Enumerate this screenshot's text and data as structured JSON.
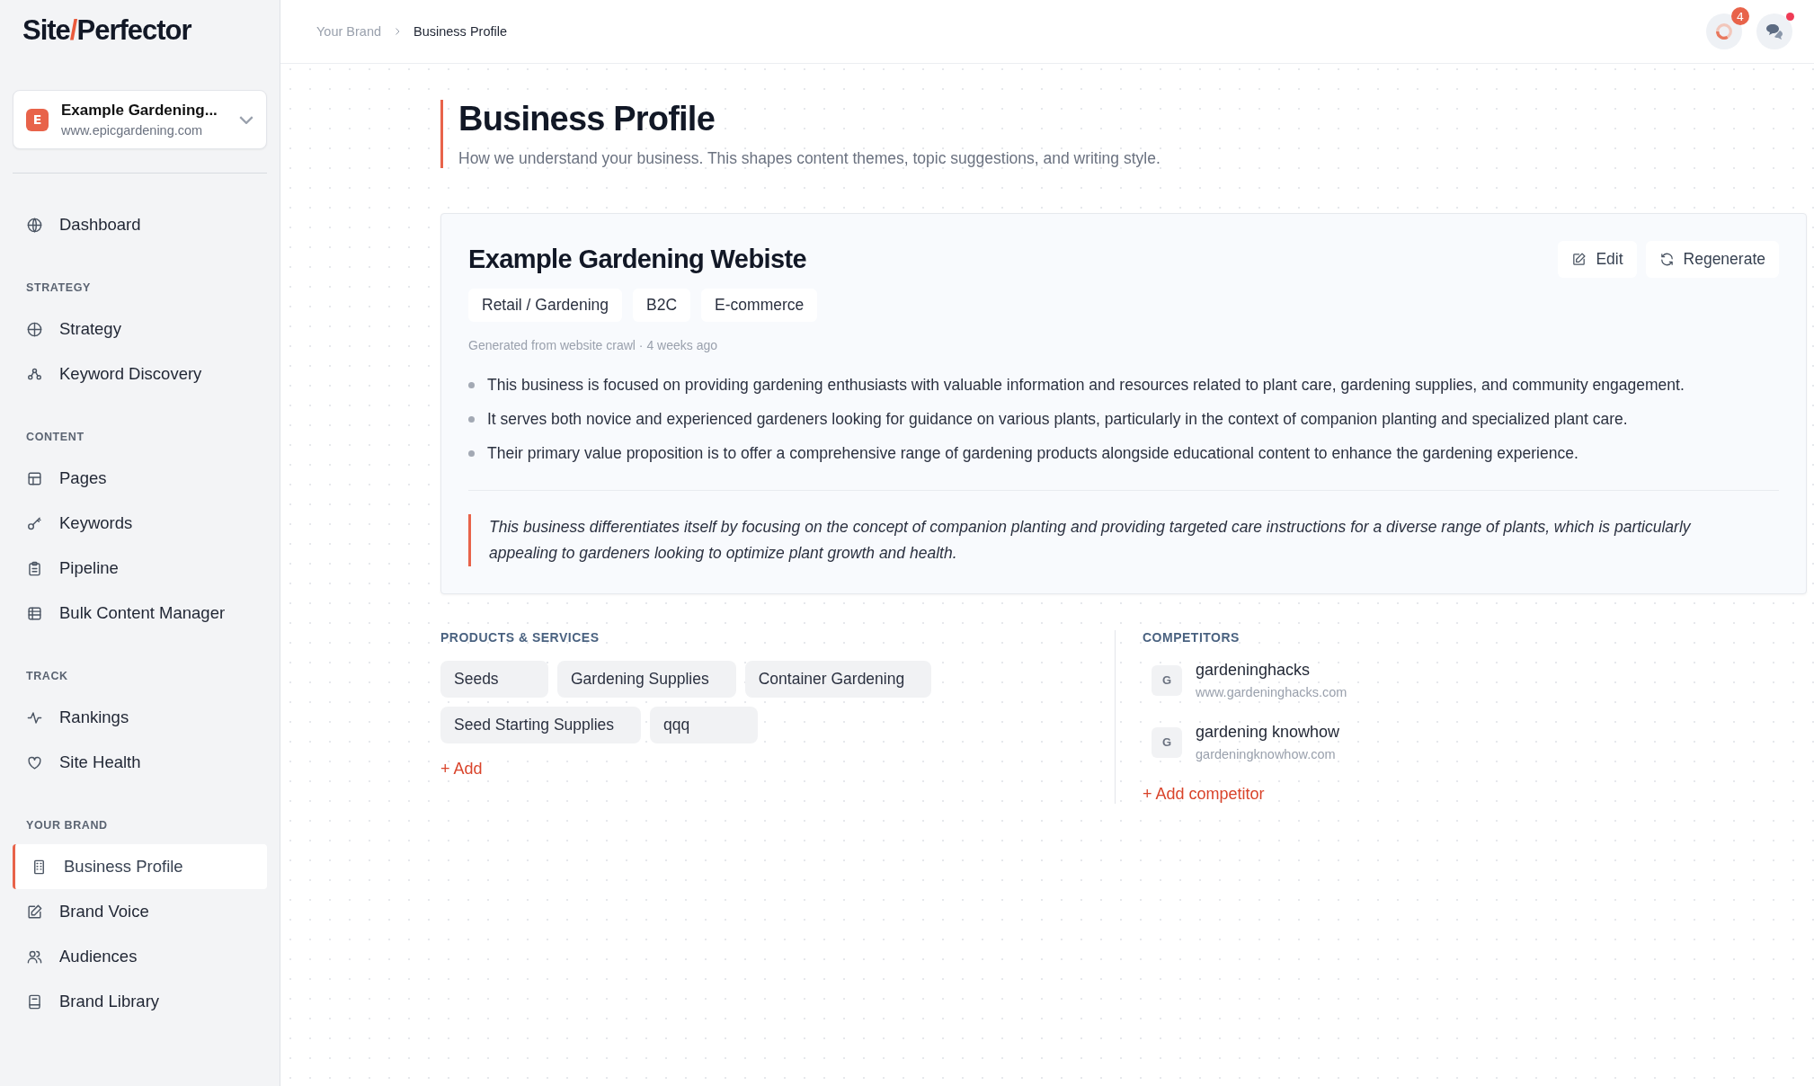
{
  "logo": [
    "Site",
    "/",
    "Perfector"
  ],
  "account": {
    "initial": "E",
    "name": "Example Gardening...",
    "url": "www.epicgardening.com"
  },
  "nav": [
    {
      "label": "Dashboard",
      "selected": false
    }
  ],
  "nav_sections": [
    {
      "title": "STRATEGY",
      "items": [
        {
          "label": "Strategy",
          "selected": false
        },
        {
          "label": "Keyword Discovery",
          "selected": false
        }
      ]
    },
    {
      "title": "CONTENT",
      "items": [
        {
          "label": "Pages",
          "selected": false
        },
        {
          "label": "Keywords",
          "selected": false
        },
        {
          "label": "Pipeline",
          "selected": false
        },
        {
          "label": "Bulk Content Manager",
          "selected": false
        }
      ]
    },
    {
      "title": "TRACK",
      "items": [
        {
          "label": "Rankings",
          "selected": false
        },
        {
          "label": "Site Health",
          "selected": false
        }
      ]
    },
    {
      "title": "YOUR BRAND",
      "items": [
        {
          "label": "Business Profile",
          "selected": true
        },
        {
          "label": "Brand Voice",
          "selected": false
        },
        {
          "label": "Audiences",
          "selected": false
        },
        {
          "label": "Brand Library",
          "selected": false
        }
      ]
    }
  ],
  "breadcrumb": [
    "Your Brand",
    "Business Profile"
  ],
  "header": {
    "notification_count": "4",
    "chat_unread": true
  },
  "page": {
    "title": "Business Profile",
    "subtitle": "How we understand your business. This shapes content themes, topic suggestions, and writing style."
  },
  "profile": {
    "name": "Example Gardening Webiste",
    "buttons": [
      "Edit",
      "Regenerate"
    ],
    "tags": [
      "Retail / Gardening",
      "B2C",
      "E-commerce"
    ],
    "meta": "Generated from website crawl · 4 weeks ago",
    "bullets": [
      "This business is focused on providing gardening enthusiasts with valuable information and resources related to plant care, gardening supplies, and community engagement.",
      "It serves both novice and experienced gardeners looking for guidance on various plants, particularly in the context of companion planting and specialized plant care.",
      "Their primary value proposition is to offer a comprehensive range of gardening products alongside educational content to enhance the gardening experience."
    ],
    "differentiator": "This business differentiates itself by focusing on the concept of companion planting and providing targeted care instructions for a diverse range of plants, which is particularly appealing to gardeners looking to optimize plant growth and health."
  },
  "products": {
    "title": "PRODUCTS & SERVICES",
    "items": [
      "Seeds",
      "Gardening Supplies",
      "Container Gardening",
      "Seed Starting Supplies",
      "qqq"
    ],
    "add": "+ Add"
  },
  "competitors": {
    "title": "COMPETITORS",
    "items": [
      {
        "initial": "G",
        "name": "gardeninghacks",
        "url": "www.gardeninghacks.com"
      },
      {
        "initial": "G",
        "name": "gardening knowhow",
        "url": "gardeningknowhow.com"
      }
    ],
    "add": "+ Add competitor"
  }
}
